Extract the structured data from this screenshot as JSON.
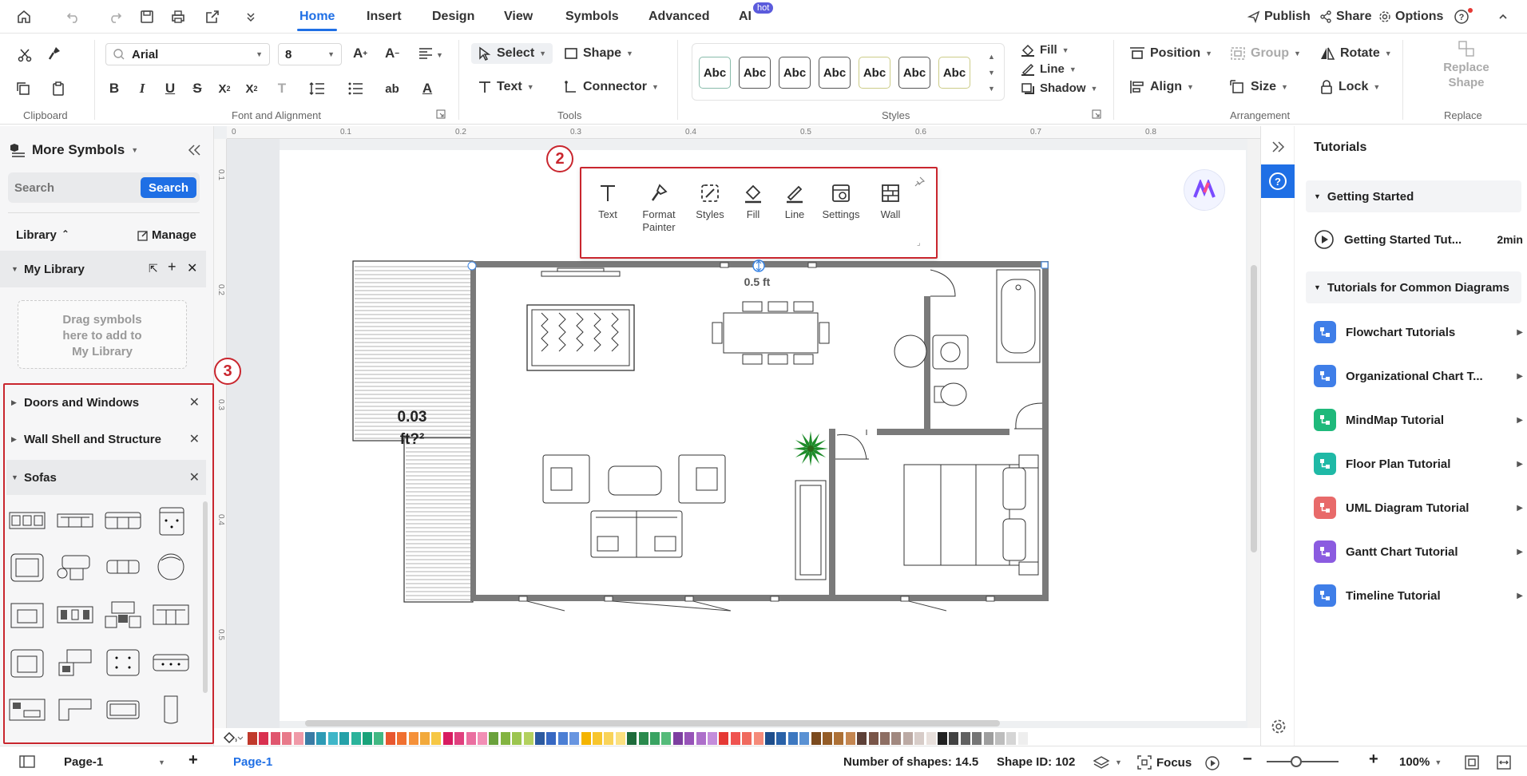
{
  "menubar": {
    "tabs": [
      "Home",
      "Insert",
      "Design",
      "View",
      "Symbols",
      "Advanced",
      "AI"
    ],
    "active_tab": "Home",
    "hot_badge": "hot",
    "right": {
      "publish": "Publish",
      "share": "Share",
      "options": "Options"
    }
  },
  "ribbon": {
    "clipboard_label": "Clipboard",
    "font": {
      "family": "Arial",
      "size": "8",
      "group_label": "Font and Alignment"
    },
    "tools": {
      "select": "Select",
      "shape": "Shape",
      "text": "Text",
      "connector": "Connector",
      "group_label": "Tools"
    },
    "styles": {
      "sample": "Abc",
      "fill": "Fill",
      "line": "Line",
      "shadow": "Shadow",
      "group_label": "Styles"
    },
    "arrangement": {
      "position": "Position",
      "group": "Group",
      "rotate": "Rotate",
      "align": "Align",
      "size": "Size",
      "lock": "Lock",
      "group_label": "Arrangement"
    },
    "replace": {
      "line1": "Replace",
      "line2": "Shape",
      "group_label": "Replace"
    }
  },
  "leftpanel": {
    "title": "More Symbols",
    "search_placeholder": "Search",
    "search_button": "Search",
    "library_label": "Library",
    "manage_label": "Manage",
    "my_library": "My Library",
    "drag_hint_1": "Drag symbols",
    "drag_hint_2": "here to add to",
    "drag_hint_3": "My Library",
    "categories": [
      "Doors and Windows",
      "Wall Shell and Structure",
      "Sofas"
    ]
  },
  "canvas": {
    "ruler_h": [
      "0",
      "0.1",
      "0.2",
      "0.3",
      "0.4",
      "0.5",
      "0.6",
      "0.7",
      "0.8"
    ],
    "ruler_v": [
      "0.1",
      "0.2",
      "0.3",
      "0.4",
      "0.5"
    ],
    "area_label_1": "0.03",
    "area_label_2": "ft?²",
    "dimension_label": "0.5 ft",
    "badge_2": "2",
    "badge_3": "3"
  },
  "floating_toolbar": {
    "items": [
      "Text",
      "Format Painter",
      "Styles",
      "Fill",
      "Line",
      "Settings",
      "Wall"
    ],
    "format_1": "Format",
    "format_2": "Painter"
  },
  "rightpanel": {
    "title": "Tutorials",
    "getting_started": "Getting Started",
    "getting_started_item": "Getting Started Tut...",
    "getting_started_duration": "2min",
    "common_diagrams": "Tutorials for Common Diagrams",
    "tutorials": [
      {
        "label": "Flowchart Tutorials",
        "color": "#3f7ee8"
      },
      {
        "label": "Organizational Chart T...",
        "color": "#3f7ee8"
      },
      {
        "label": "MindMap Tutorial",
        "color": "#1fb97b"
      },
      {
        "label": "Floor Plan Tutorial",
        "color": "#1fb9a6"
      },
      {
        "label": "UML Diagram Tutorial",
        "color": "#e86a6a"
      },
      {
        "label": "Gantt Chart Tutorial",
        "color": "#8b5be0"
      },
      {
        "label": "Timeline Tutorial",
        "color": "#3f7ee8"
      }
    ]
  },
  "statusbar": {
    "page_name": "Page-1",
    "page_tab": "Page-1",
    "shapes_count": "Number of shapes: 14.5",
    "shape_id": "Shape ID: 102",
    "focus": "Focus",
    "zoom": "100%"
  }
}
